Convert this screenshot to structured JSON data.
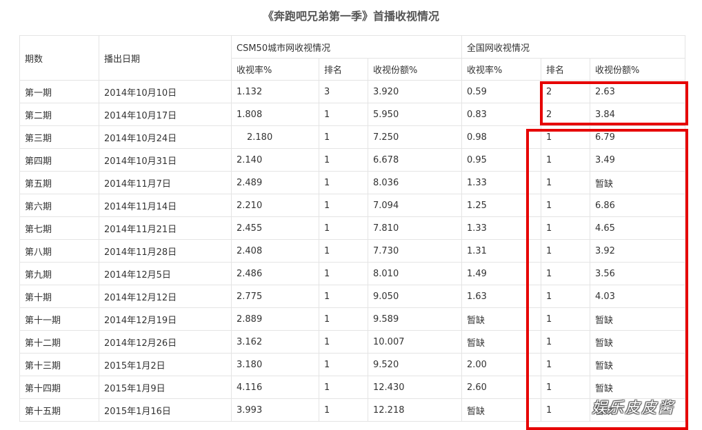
{
  "title": "《奔跑吧兄弟第一季》首播收视情况",
  "table": {
    "header": {
      "episode": "期数",
      "air_date": "播出日期",
      "group_csm50": "CSM50城市网收视情况",
      "group_national": "全国网收视情况",
      "rating": "收视率%",
      "rank": "排名",
      "share": "收视份额%"
    },
    "rows": [
      [
        "第一期",
        "2014年10月10日",
        "1.132",
        "3",
        "3.920",
        "0.59",
        "2",
        "2.63"
      ],
      [
        "第二期",
        "2014年10月17日",
        "1.808",
        "1",
        "5.950",
        "0.83",
        "2",
        "3.84"
      ],
      [
        "第三期",
        "2014年10月24日",
        "2.180",
        "1",
        "7.250",
        "0.98",
        "1",
        "6.79"
      ],
      [
        "第四期",
        "2014年10月31日",
        "2.140",
        "1",
        "6.678",
        "0.95",
        "1",
        "3.49"
      ],
      [
        "第五期",
        "2014年11月7日",
        "2.489",
        "1",
        "8.036",
        "1.33",
        "1",
        "暂缺"
      ],
      [
        "第六期",
        "2014年11月14日",
        "2.210",
        "1",
        "7.094",
        "1.25",
        "1",
        "6.86"
      ],
      [
        "第七期",
        "2014年11月21日",
        "2.455",
        "1",
        "7.810",
        "1.33",
        "1",
        "4.65"
      ],
      [
        "第八期",
        "2014年11月28日",
        "2.408",
        "1",
        "7.730",
        "1.31",
        "1",
        "3.92"
      ],
      [
        "第九期",
        "2014年12月5日",
        "2.486",
        "1",
        "8.010",
        "1.49",
        "1",
        "3.56"
      ],
      [
        "第十期",
        "2014年12月12日",
        "2.775",
        "1",
        "9.050",
        "1.63",
        "1",
        "4.03"
      ],
      [
        "第十一期",
        "2014年12月19日",
        "2.889",
        "1",
        "9.589",
        "暂缺",
        "1",
        "暂缺"
      ],
      [
        "第十二期",
        "2014年12月26日",
        "3.162",
        "1",
        "10.007",
        "暂缺",
        "1",
        "暂缺"
      ],
      [
        "第十三期",
        "2015年1月2日",
        "3.180",
        "1",
        "9.520",
        "2.00",
        "1",
        "暂缺"
      ],
      [
        "第十四期",
        "2015年1月9日",
        "4.116",
        "1",
        "12.430",
        "2.60",
        "1",
        "暂缺"
      ],
      [
        "第十五期",
        "2015年1月16日",
        "3.993",
        "1",
        "12.218",
        "暂缺",
        "1",
        "暂缺"
      ]
    ]
  },
  "highlight_color": "#e60000",
  "watermark": "娱乐皮皮酱"
}
